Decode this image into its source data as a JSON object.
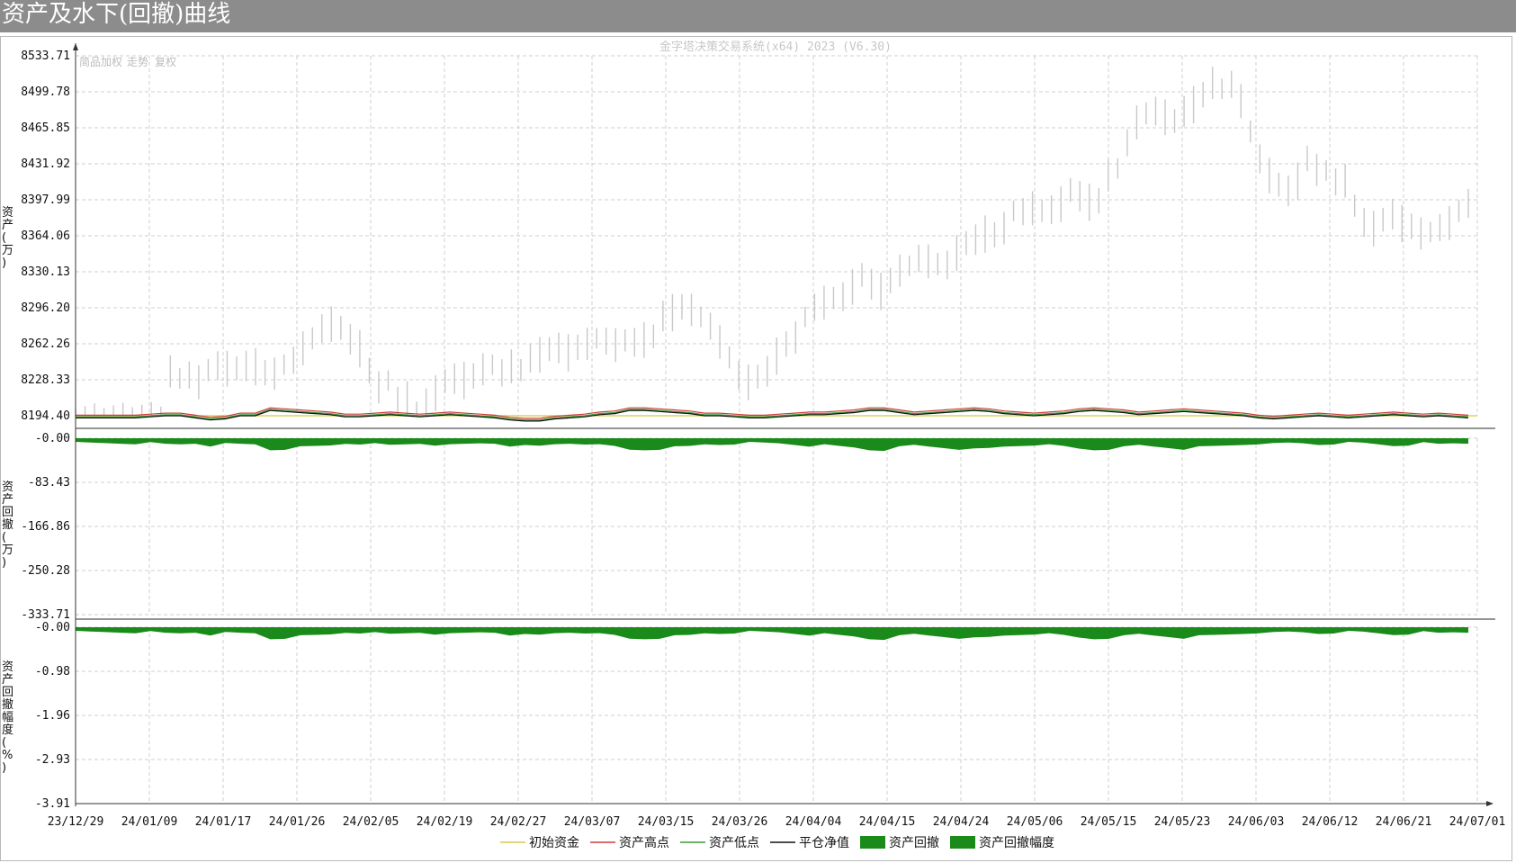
{
  "window": {
    "title": "资产及水下(回撤)曲线"
  },
  "watermark": "金字塔决策交易系统(x64) 2023 (V6.30)",
  "topleft_options": [
    "简品加权",
    "走势",
    "复权"
  ],
  "colors": {
    "initial": "#d8c84a",
    "high": "#d23b3b",
    "low": "#3c9a3c",
    "closeout": "#111111",
    "drawdown": "#1a8a1a",
    "grid": "#cfcfcf",
    "bars": "#c8c8c8"
  },
  "chart_data": [
    {
      "type": "line",
      "panel": "asset",
      "ylabel": "资产(万)",
      "yticks": [
        "8533.71",
        "8499.78",
        "8465.85",
        "8431.92",
        "8397.99",
        "8364.06",
        "8330.13",
        "8296.20",
        "8262.26",
        "8228.33",
        "8194.40"
      ],
      "ylim": [
        8194.4,
        8533.71
      ],
      "xticks": [
        "23/12/29",
        "24/01/09",
        "24/01/17",
        "24/01/26",
        "24/02/05",
        "24/02/19",
        "24/02/27",
        "24/03/07",
        "24/03/15",
        "24/03/26",
        "24/04/04",
        "24/04/15",
        "24/04/24",
        "24/05/06",
        "24/05/15",
        "24/05/23",
        "24/06/03",
        "24/06/12",
        "24/06/21",
        "24/07/01"
      ],
      "price_bars_mid": [
        8194,
        8194,
        8194,
        8194,
        8194,
        8194,
        8194,
        8194,
        8194,
        8194,
        8240,
        8232,
        8236,
        8230,
        8240,
        8245,
        8243,
        8242,
        8245,
        8245,
        8238,
        8238,
        8245,
        8250,
        8262,
        8270,
        8280,
        8285,
        8280,
        8270,
        8262,
        8240,
        8225,
        8230,
        8212,
        8215,
        8200,
        8210,
        8220,
        8230,
        8233,
        8232,
        8235,
        8242,
        8245,
        8238,
        8245,
        8240,
        8252,
        8256,
        8260,
        8262,
        8258,
        8262,
        8266,
        8270,
        8268,
        8265,
        8268,
        8267,
        8270,
        8272,
        8292,
        8296,
        8300,
        8298,
        8290,
        8282,
        8268,
        8252,
        8236,
        8230,
        8234,
        8240,
        8255,
        8265,
        8272,
        8290,
        8300,
        8305,
        8308,
        8310,
        8320,
        8330,
        8322,
        8316,
        8325,
        8335,
        8338,
        8346,
        8344,
        8340,
        8340,
        8352,
        8360,
        8364,
        8370,
        8368,
        8375,
        8390,
        8390,
        8394,
        8390,
        8392,
        8398,
        8410,
        8405,
        8400,
        8400,
        8425,
        8430,
        8455,
        8475,
        8482,
        8485,
        8480,
        8475,
        8485,
        8492,
        8500,
        8512,
        8505,
        8510,
        8495,
        8465,
        8440,
        8425,
        8415,
        8410,
        8420,
        8440,
        8430,
        8428,
        8418,
        8420,
        8395,
        8380,
        8375,
        8382,
        8388,
        8380,
        8376,
        8370,
        8370,
        8375,
        8380,
        8390,
        8398
      ],
      "initial_capital": 8194.4,
      "closeout_nav": [
        8194,
        8194,
        8194,
        8194,
        8194,
        8195,
        8196,
        8196,
        8194,
        8192,
        8193,
        8196,
        8196,
        8201,
        8200,
        8199,
        8198,
        8197,
        8195,
        8195,
        8196,
        8197,
        8196,
        8195,
        8196,
        8197,
        8196,
        8195,
        8194,
        8192,
        8191,
        8191,
        8193,
        8194,
        8195,
        8197,
        8198,
        8201,
        8201,
        8200,
        8199,
        8198,
        8196,
        8196,
        8195,
        8194,
        8194,
        8195,
        8196,
        8197,
        8197,
        8198,
        8199,
        8201,
        8201,
        8199,
        8197,
        8198,
        8199,
        8200,
        8201,
        8200,
        8198,
        8197,
        8196,
        8197,
        8198,
        8200,
        8201,
        8200,
        8199,
        8197,
        8198,
        8199,
        8200,
        8199,
        8198,
        8197,
        8196,
        8194,
        8193,
        8194,
        8195,
        8196,
        8195,
        8194,
        8195,
        8196,
        8197,
        8196,
        8195,
        8196,
        8195,
        8194
      ]
    },
    {
      "type": "area",
      "panel": "drawdown",
      "ylabel": "资产回撤(万)",
      "yticks": [
        "-0.00",
        "-83.43",
        "-166.86",
        "-250.28",
        "-333.71"
      ],
      "ylim": [
        -333.71,
        0
      ]
    },
    {
      "type": "area",
      "panel": "drawdown_pct",
      "ylabel": "资产回撤幅度(%)",
      "yticks": [
        "-0.00",
        "-0.98",
        "-1.96",
        "-2.93",
        "-3.91"
      ],
      "ylim": [
        -3.91,
        0
      ]
    }
  ],
  "legend": [
    {
      "label": "初始资金",
      "kind": "line",
      "color": "#d8c84a"
    },
    {
      "label": "资产高点",
      "kind": "line",
      "color": "#d23b3b"
    },
    {
      "label": "资产低点",
      "kind": "line",
      "color": "#3c9a3c"
    },
    {
      "label": "平仓净值",
      "kind": "line",
      "color": "#111111"
    },
    {
      "label": "资产回撤",
      "kind": "box",
      "color": "#1a8a1a"
    },
    {
      "label": "资产回撤幅度",
      "kind": "box",
      "color": "#1a8a1a"
    }
  ]
}
